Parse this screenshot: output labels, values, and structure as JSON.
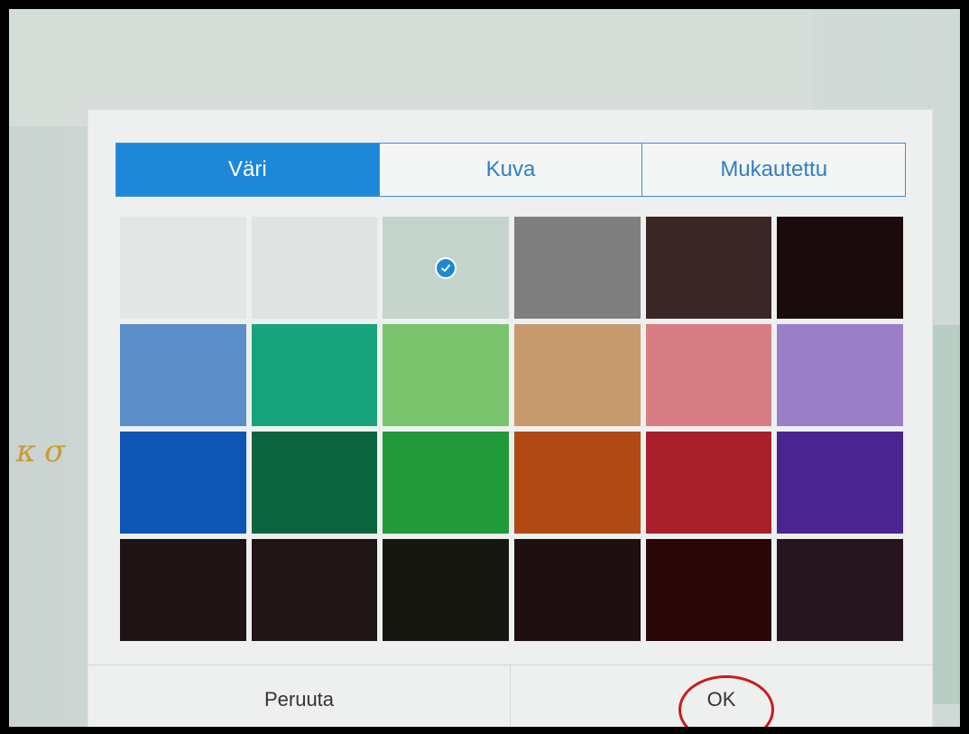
{
  "tabs": [
    {
      "label": "Väri",
      "active": true
    },
    {
      "label": "Kuva",
      "active": false
    },
    {
      "label": "Mukautettu",
      "active": false
    }
  ],
  "swatches": [
    {
      "color": "#e2e6e4"
    },
    {
      "color": "#dfe4e2"
    },
    {
      "color": "#c4d4cc",
      "selected": true
    },
    {
      "color": "#7f7f7f"
    },
    {
      "color": "#3a2624"
    },
    {
      "color": "#1a0c0c"
    },
    {
      "color": "#5b8ec9"
    },
    {
      "color": "#17a37c"
    },
    {
      "color": "#79c46d"
    },
    {
      "color": "#c69a6d"
    },
    {
      "color": "#d77d84"
    },
    {
      "color": "#9b7ec8"
    },
    {
      "color": "#0d56b4"
    },
    {
      "color": "#0a643e"
    },
    {
      "color": "#229a39"
    },
    {
      "color": "#b14914"
    },
    {
      "color": "#a7202a"
    },
    {
      "color": "#4a2490"
    },
    {
      "color": "#1e1415"
    },
    {
      "color": "#1f1514"
    },
    {
      "color": "#151710"
    },
    {
      "color": "#1e0f10"
    },
    {
      "color": "#2a0808"
    },
    {
      "color": "#24151f"
    }
  ],
  "footer": {
    "cancel_label": "Peruuta",
    "ok_label": "OK"
  },
  "accent": "#1e88d8",
  "highlight_color": "#cc1a1a"
}
